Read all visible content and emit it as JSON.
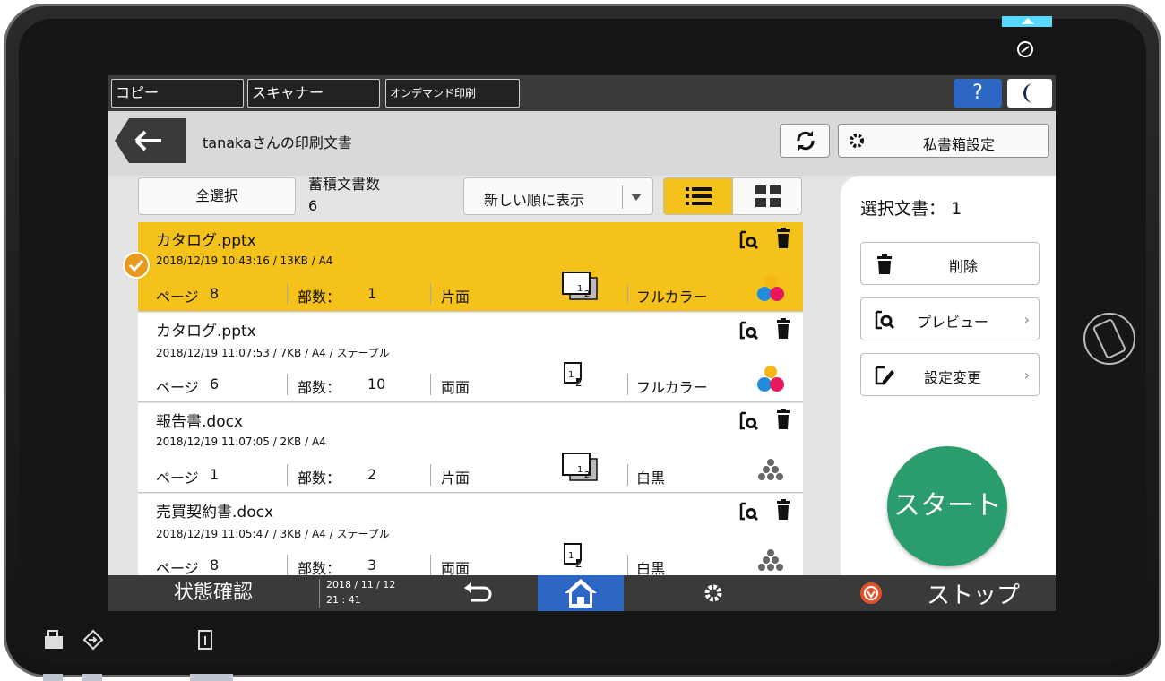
{
  "top_tabs": [
    "コピー",
    "スキャナー",
    "オンデマンド印刷"
  ],
  "help_label": "?",
  "header": {
    "title": "tanakaさんの印刷文書",
    "box_settings_label": "私書箱設定"
  },
  "toolbar": {
    "select_all_label": "全選択",
    "count_label": "蓄積文書数",
    "count_value": "6",
    "sort_label": "新しい順に表示"
  },
  "documents": [
    {
      "name": "カタログ.pptx",
      "meta": "2018/12/19 10:43:16 / 13KB / A4",
      "pages_label": "ページ",
      "pages": "8",
      "copies_label": "部数：",
      "copies": "1",
      "sides": "片面",
      "color": "フルカラー",
      "selected": true,
      "duplex_icon": "simplex-icon",
      "color_icon": "full-color-icon"
    },
    {
      "name": "カタログ.pptx",
      "meta": "2018/12/19 11:07:53 / 7KB / A4 / ステープル",
      "pages_label": "ページ",
      "pages": "6",
      "copies_label": "部数：",
      "copies": "10",
      "sides": "両面",
      "color": "フルカラー",
      "selected": false,
      "duplex_icon": "duplex-icon",
      "color_icon": "full-color-icon"
    },
    {
      "name": "報告書.docx",
      "meta": "2018/12/19 11:07:05 / 2KB / A4",
      "pages_label": "ページ",
      "pages": "1",
      "copies_label": "部数：",
      "copies": "2",
      "sides": "片面",
      "color": "白黒",
      "selected": false,
      "duplex_icon": "simplex-icon",
      "color_icon": "black-white-icon"
    },
    {
      "name": "売買契約書.docx",
      "meta": "2018/12/19 11:05:47 / 3KB / A4 / ステープル",
      "pages_label": "ページ",
      "pages": "8",
      "copies_label": "部数：",
      "copies": "3",
      "sides": "両面",
      "color": "白黒",
      "selected": false,
      "duplex_icon": "duplex-icon",
      "color_icon": "black-white-icon"
    }
  ],
  "side_panel": {
    "selected_label": "選択文書：",
    "selected_count": "1",
    "delete_label": "削除",
    "preview_label": "プレビュー",
    "change_settings_label": "設定変更",
    "start_label": "スタート"
  },
  "bottom_bar": {
    "status_label": "状態確認",
    "date": "2018 / 11 / 12",
    "time": "21 : 41",
    "stop_label": "ストップ"
  },
  "colors": {
    "accent_yellow": "#f4c21a",
    "home_blue": "#2c67c4",
    "start_green": "#2b9c6b",
    "stop_red": "#e2532b"
  }
}
